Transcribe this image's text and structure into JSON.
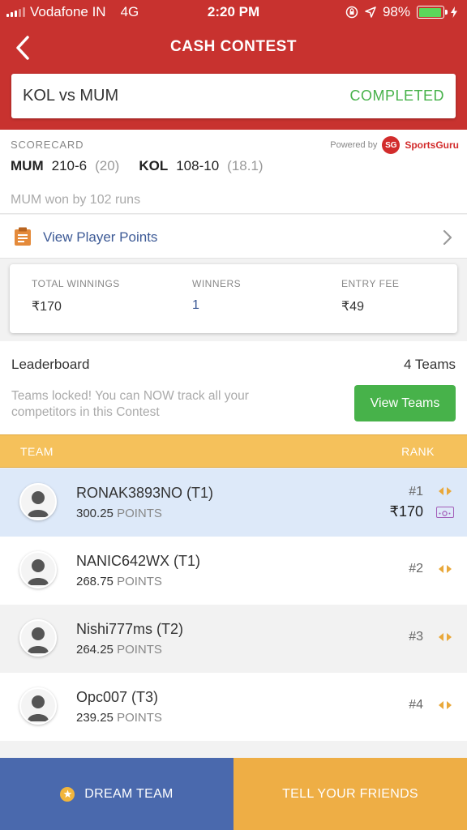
{
  "status_bar": {
    "carrier": "Vodafone IN",
    "network": "4G",
    "time": "2:20 PM",
    "battery": "98%",
    "battery_level": 0.98
  },
  "header": {
    "title": "CASH CONTEST",
    "back_icon": "chevron-left-icon",
    "color": "#c8322f"
  },
  "match": {
    "teams": "KOL vs MUM",
    "status": "COMPLETED",
    "status_color": "#47b24a"
  },
  "scorecard": {
    "label": "SCORECARD",
    "powered_by": "Powered by",
    "brand_mark": "SG",
    "brand_name": "SportsGuru",
    "team1": "MUM",
    "team1_score": "210-6",
    "team1_overs": "(20)",
    "team2": "KOL",
    "team2_score": "108-10",
    "team2_overs": "(18.1)",
    "result": "MUM won by 102 runs"
  },
  "player_points": {
    "label": "View Player Points",
    "icon": "clipboard-icon"
  },
  "winnings": {
    "total_label": "TOTAL WINNINGS",
    "total_value": "₹170",
    "winners_label": "WINNERS",
    "winners_value": "1",
    "fee_label": "ENTRY FEE",
    "fee_value": "₹49"
  },
  "leaderboard": {
    "title": "Leaderboard",
    "count": "4 Teams",
    "message": "Teams locked! You can NOW track all your competitors in this Contest",
    "button": "View Teams",
    "col_team": "TEAM",
    "col_rank": "RANK"
  },
  "rows": [
    {
      "name": "RONAK3893NO (T1)",
      "points": "300.25",
      "points_label": "POINTS",
      "rank": "#1",
      "prize": "₹170"
    },
    {
      "name": "NANIC642WX (T1)",
      "points": "268.75",
      "points_label": "POINTS",
      "rank": "#2"
    },
    {
      "name": "Nishi777ms (T2)",
      "points": "264.25",
      "points_label": "POINTS",
      "rank": "#3"
    },
    {
      "name": "Opc007 (T3)",
      "points": "239.25",
      "points_label": "POINTS",
      "rank": "#4"
    }
  ],
  "footer": {
    "dream_team": "DREAM TEAM",
    "tell_friends": "TELL YOUR FRIENDS",
    "dream_color": "#4a69ad",
    "tell_color": "#eeae45"
  }
}
